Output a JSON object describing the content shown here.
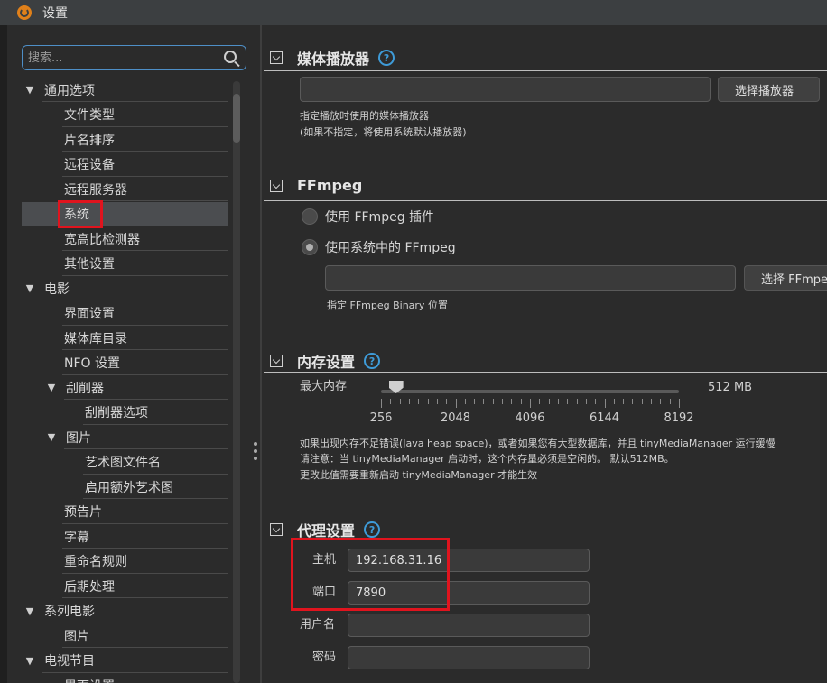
{
  "window": {
    "title": "设置"
  },
  "search": {
    "placeholder": "搜索..."
  },
  "tree": [
    {
      "label": "通用选项",
      "level": 0,
      "expanded": true
    },
    {
      "label": "文件类型",
      "level": 1
    },
    {
      "label": "片名排序",
      "level": 1
    },
    {
      "label": "远程设备",
      "level": 1
    },
    {
      "label": "远程服务器",
      "level": 1
    },
    {
      "label": "系统",
      "level": 1,
      "selected": true
    },
    {
      "label": "宽高比检测器",
      "level": 1
    },
    {
      "label": "其他设置",
      "level": 1
    },
    {
      "label": "电影",
      "level": 0,
      "expanded": true
    },
    {
      "label": "界面设置",
      "level": 1
    },
    {
      "label": "媒体库目录",
      "level": 1
    },
    {
      "label": "NFO 设置",
      "level": 1
    },
    {
      "label": "刮削器",
      "level": 1,
      "expanded": true
    },
    {
      "label": "刮削器选项",
      "level": 2
    },
    {
      "label": "图片",
      "level": 1,
      "expanded": true
    },
    {
      "label": "艺术图文件名",
      "level": 2
    },
    {
      "label": "启用额外艺术图",
      "level": 2
    },
    {
      "label": "预告片",
      "level": 1
    },
    {
      "label": "字幕",
      "level": 1
    },
    {
      "label": "重命名规则",
      "level": 1
    },
    {
      "label": "后期处理",
      "level": 1
    },
    {
      "label": "系列电影",
      "level": 0,
      "expanded": true
    },
    {
      "label": "图片",
      "level": 1
    },
    {
      "label": "电视节目",
      "level": 0,
      "expanded": true
    },
    {
      "label": "界面设置",
      "level": 1
    }
  ],
  "media_player": {
    "title": "媒体播放器",
    "path_value": "",
    "button": "选择播放器",
    "hint1": "指定播放时使用的媒体播放器",
    "hint2": "(如果不指定，将使用系统默认播放器)"
  },
  "ffmpeg": {
    "title": "FFmpeg",
    "option_plugin": "使用 FFmpeg 插件",
    "option_system": "使用系统中的 FFmpeg",
    "selected_option": "使用系统中的 FFmpeg",
    "path_value": "",
    "button": "选择 FFmpeg",
    "hint": "指定 FFmpeg Binary 位置"
  },
  "memory": {
    "title": "内存设置",
    "label": "最大内存",
    "value_mb": 512,
    "value_text": "512 MB",
    "min": 256,
    "max": 8192,
    "tick_labels": [
      "256",
      "2048",
      "4096",
      "6144",
      "8192"
    ],
    "note1": "如果出现内存不足错误(Java heap space)，或者如果您有大型数据库，并且 tinyMediaManager 运行缓慢",
    "note2": "请注意：当 tinyMediaManager 启动时，这个内存量必须是空闲的。 默认512MB。",
    "note3": "更改此值需要重新启动 tinyMediaManager 才能生效"
  },
  "proxy": {
    "title": "代理设置",
    "host_label": "主机",
    "host_value": "192.168.31.16",
    "port_label": "端口",
    "port_value": "7890",
    "user_label": "用户名",
    "user_value": "",
    "password_label": "密码",
    "password_value": ""
  },
  "colors": {
    "background": "#2b2b2b",
    "accent": "#3e9bd8",
    "highlight_box": "#e0141e"
  }
}
